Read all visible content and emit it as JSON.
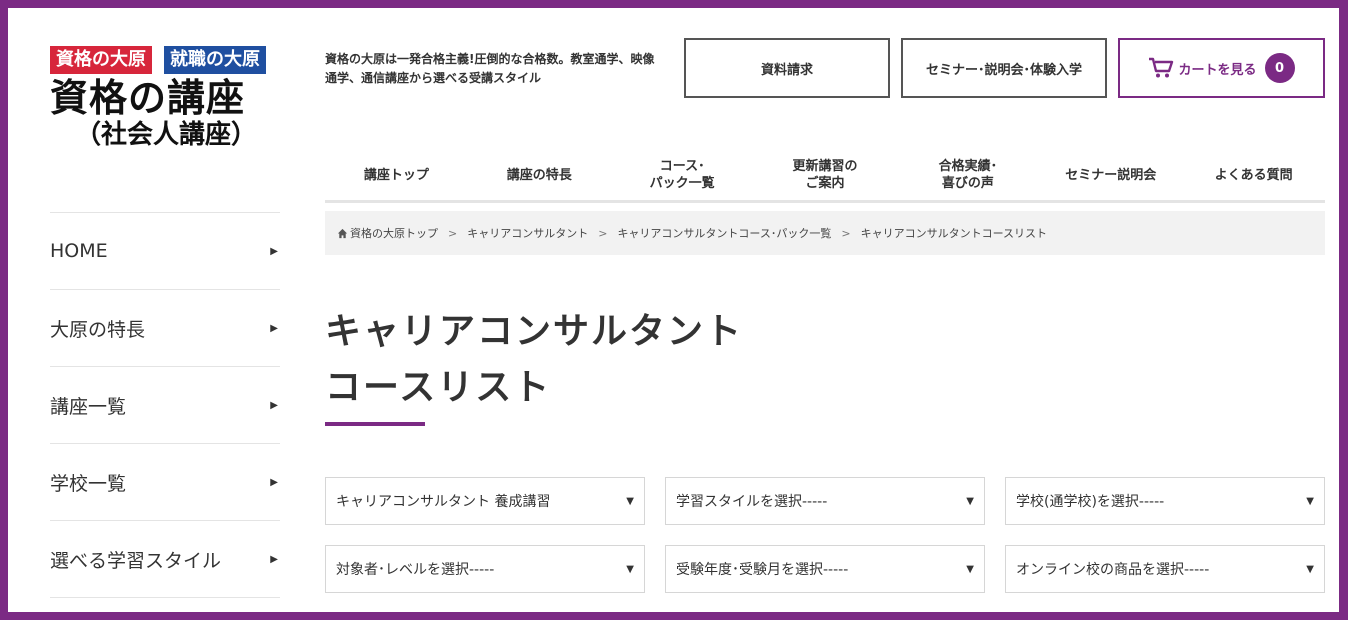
{
  "logo": {
    "badge_left": "資格の大原",
    "badge_right": "就職の大原",
    "main": "資格の講座",
    "sub": "（社会人講座）"
  },
  "sidebar": {
    "items": [
      {
        "label": "HOME"
      },
      {
        "label": "大原の特長"
      },
      {
        "label": "講座一覧"
      },
      {
        "label": "学校一覧"
      },
      {
        "label": "選べる学習スタイル"
      }
    ]
  },
  "header": {
    "tagline": "資格の大原は一発合格主義!圧倒的な合格数。教室通学、映像通学、通信講座から選べる受講スタイル",
    "request_label": "資料請求",
    "seminar_label": "セミナー･説明会･体験入学",
    "cart_label": "カートを見る",
    "cart_count": "0"
  },
  "mainnav": {
    "items": [
      {
        "label": "講座トップ"
      },
      {
        "label": "講座の特長"
      },
      {
        "label": "コース･\nパック一覧"
      },
      {
        "label": "更新講習の\nご案内"
      },
      {
        "label": "合格実績･\n喜びの声"
      },
      {
        "label": "セミナー説明会"
      },
      {
        "label": "よくある質問"
      }
    ]
  },
  "breadcrumb": {
    "items": [
      {
        "label": "資格の大原トップ"
      },
      {
        "label": "キャリアコンサルタント"
      },
      {
        "label": "キャリアコンサルタントコース･パック一覧"
      },
      {
        "label": "キャリアコンサルタントコースリスト"
      }
    ],
    "separator": ">"
  },
  "page": {
    "title_line1": "キャリアコンサルタント",
    "title_line2": "コースリスト"
  },
  "filters": [
    {
      "value": "キャリアコンサルタント 養成講習"
    },
    {
      "value": "学習スタイルを選択-----"
    },
    {
      "value": "学校(通学校)を選択-----"
    },
    {
      "value": "対象者･レベルを選択-----"
    },
    {
      "value": "受験年度･受験月を選択-----"
    },
    {
      "value": "オンライン校の商品を選択-----"
    }
  ],
  "colors": {
    "accent": "#7b2a84",
    "badge_red": "#d7263b",
    "badge_blue": "#1f4fa0"
  },
  "icons": {
    "cart": "cart-icon",
    "home": "home-icon",
    "sidebar_arrow": "chevron-right-icon",
    "select_caret": "caret-down-icon"
  }
}
